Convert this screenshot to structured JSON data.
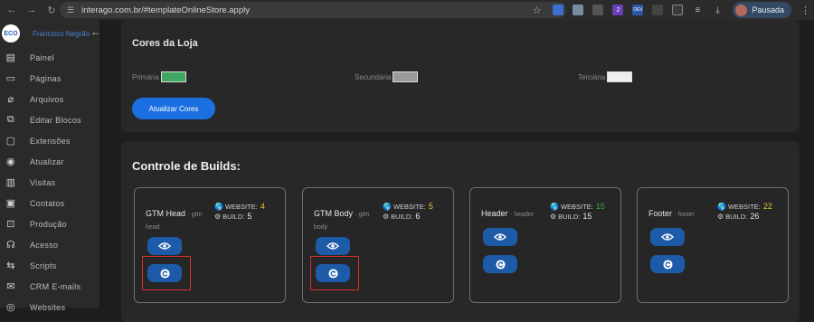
{
  "browser": {
    "url": "interago.com.br/#templateOnlineStore.apply",
    "profile_label": "Pausada",
    "ext_badge": "2",
    "ext_badge2": "DEV"
  },
  "sidebar": {
    "user_name": "Francisco Negrão",
    "logo_text": "ECO",
    "items": [
      {
        "label": "Painel",
        "icon": "dashboard-icon"
      },
      {
        "label": "Páginas",
        "icon": "pages-icon"
      },
      {
        "label": "Arquivos",
        "icon": "paperclip-icon"
      },
      {
        "label": "Editar Blocos",
        "icon": "blocks-icon"
      },
      {
        "label": "Extensões",
        "icon": "extensions-icon"
      },
      {
        "label": "Atualizar",
        "icon": "refresh-icon"
      },
      {
        "label": "Visitas",
        "icon": "chart-icon"
      },
      {
        "label": "Contatos",
        "icon": "contacts-icon"
      },
      {
        "label": "Produção",
        "icon": "production-icon"
      },
      {
        "label": "Acesso",
        "icon": "users-icon"
      },
      {
        "label": "Scripts",
        "icon": "scripts-icon"
      },
      {
        "label": "CRM E-mails",
        "icon": "mail-icon"
      },
      {
        "label": "Websites",
        "icon": "globe-icon"
      }
    ]
  },
  "colors_panel": {
    "title": "Cores da Loja",
    "primary_label": "Primária",
    "primary_color": "#3fa75f",
    "secondary_label": "Secundária",
    "secondary_color": "#9a9a9a",
    "tertiary_label": "Terciária",
    "tertiary_color": "#efefef",
    "update_button": "Atualizar Cores"
  },
  "builds_panel": {
    "title": "Controle de Builds:",
    "cards": [
      {
        "name": "GTM Head",
        "slug": "· gtm head",
        "website_label": "WEBSITE:",
        "website": "4",
        "build_label": "BUILD:",
        "build": "5"
      },
      {
        "name": "GTM Body",
        "slug": "· gtm body",
        "website_label": "WEBSITE:",
        "website": "5",
        "build_label": "BUILD:",
        "build": "6"
      },
      {
        "name": "Header",
        "slug": "· header",
        "website_label": "WEBSITE:",
        "website": "15",
        "build_label": "BUILD:",
        "build": "15"
      },
      {
        "name": "Footer",
        "slug": "· footer",
        "website_label": "WEBSITE:",
        "website": "22",
        "build_label": "BUILD:",
        "build": "26"
      }
    ]
  }
}
